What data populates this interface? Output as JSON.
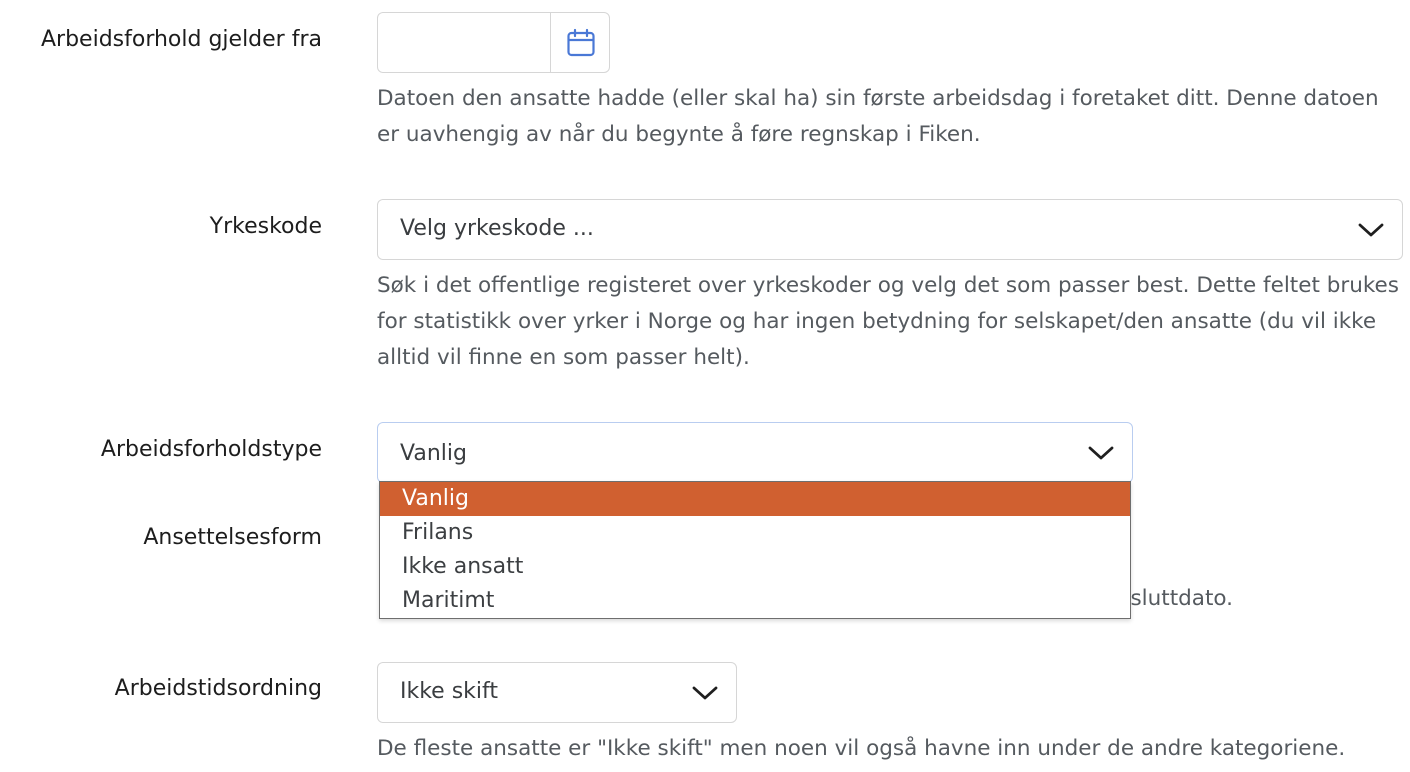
{
  "fields": {
    "start_date": {
      "label": "Arbeidsforhold gjelder fra",
      "value": "",
      "help": "Datoen den ansatte hadde (eller skal ha) sin første arbeidsdag i foretaket ditt. Denne datoen er uavhengig av når du begynte å føre regnskap i Fiken."
    },
    "occupation": {
      "label": "Yrkeskode",
      "value": "Velg yrkeskode ...",
      "help": "Søk i det offentlige registeret over yrkeskoder og velg det som passer best. Dette feltet brukes for statistikk over yrker i Norge og har ingen betydning for selskapet/den ansatte (du vil ikke alltid vil finne en som passer helt)."
    },
    "employment_type": {
      "label": "Arbeidsforholdstype",
      "value": "Vanlig",
      "options": [
        "Vanlig",
        "Frilans",
        "Ikke ansatt",
        "Maritimt"
      ]
    },
    "employment_form": {
      "label": "Ansettelsesform",
      "help_fragment": "n sluttdato."
    },
    "working_hours": {
      "label": "Arbeidstidsordning",
      "value": "Ikke skift",
      "help": "De fleste ansatte er \"Ikke skift\" men noen vil også havne inn under de andre kategoriene."
    }
  },
  "colors": {
    "accent": "#d06030",
    "calendar_icon": "#4a78d6",
    "focus_border": "#b9cdf0"
  },
  "icons": [
    "calendar-icon",
    "chevron-down-icon"
  ]
}
